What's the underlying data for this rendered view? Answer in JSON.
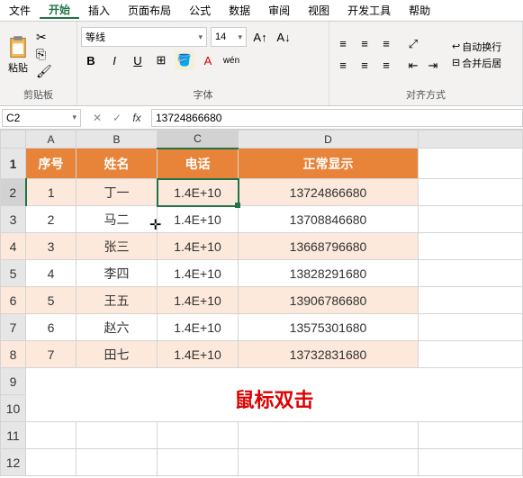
{
  "menu": {
    "items": [
      "文件",
      "开始",
      "插入",
      "页面布局",
      "公式",
      "数据",
      "审阅",
      "视图",
      "开发工具",
      "帮助"
    ],
    "active": 1
  },
  "ribbon": {
    "clipboard": {
      "paste": "粘贴",
      "label": "剪贴板"
    },
    "font": {
      "name": "等线",
      "size": "14",
      "bold": "B",
      "italic": "I",
      "underline": "U",
      "label": "字体"
    },
    "align": {
      "wrap": "自动换行",
      "merge": "合并后居",
      "label": "对齐方式"
    }
  },
  "formula_bar": {
    "cell_ref": "C2",
    "value": "13724866680"
  },
  "sheet": {
    "columns": [
      "A",
      "B",
      "C",
      "D"
    ],
    "header_row": [
      "序号",
      "姓名",
      "电话",
      "正常显示"
    ],
    "rows": [
      {
        "n": "1",
        "name": "丁一",
        "phone": "1.4E+10",
        "full": "13724866680"
      },
      {
        "n": "2",
        "name": "马二",
        "phone": "1.4E+10",
        "full": "13708846680"
      },
      {
        "n": "3",
        "name": "张三",
        "phone": "1.4E+10",
        "full": "13668796680"
      },
      {
        "n": "4",
        "name": "李四",
        "phone": "1.4E+10",
        "full": "13828291680"
      },
      {
        "n": "5",
        "name": "王五",
        "phone": "1.4E+10",
        "full": "13906786680"
      },
      {
        "n": "6",
        "name": "赵六",
        "phone": "1.4E+10",
        "full": "13575301680"
      },
      {
        "n": "7",
        "name": "田七",
        "phone": "1.4E+10",
        "full": "13732831680"
      }
    ],
    "selected_cell": "C2",
    "empty_rows": [
      "9",
      "10",
      "11",
      "12"
    ]
  },
  "annotation": "鼠标双击"
}
